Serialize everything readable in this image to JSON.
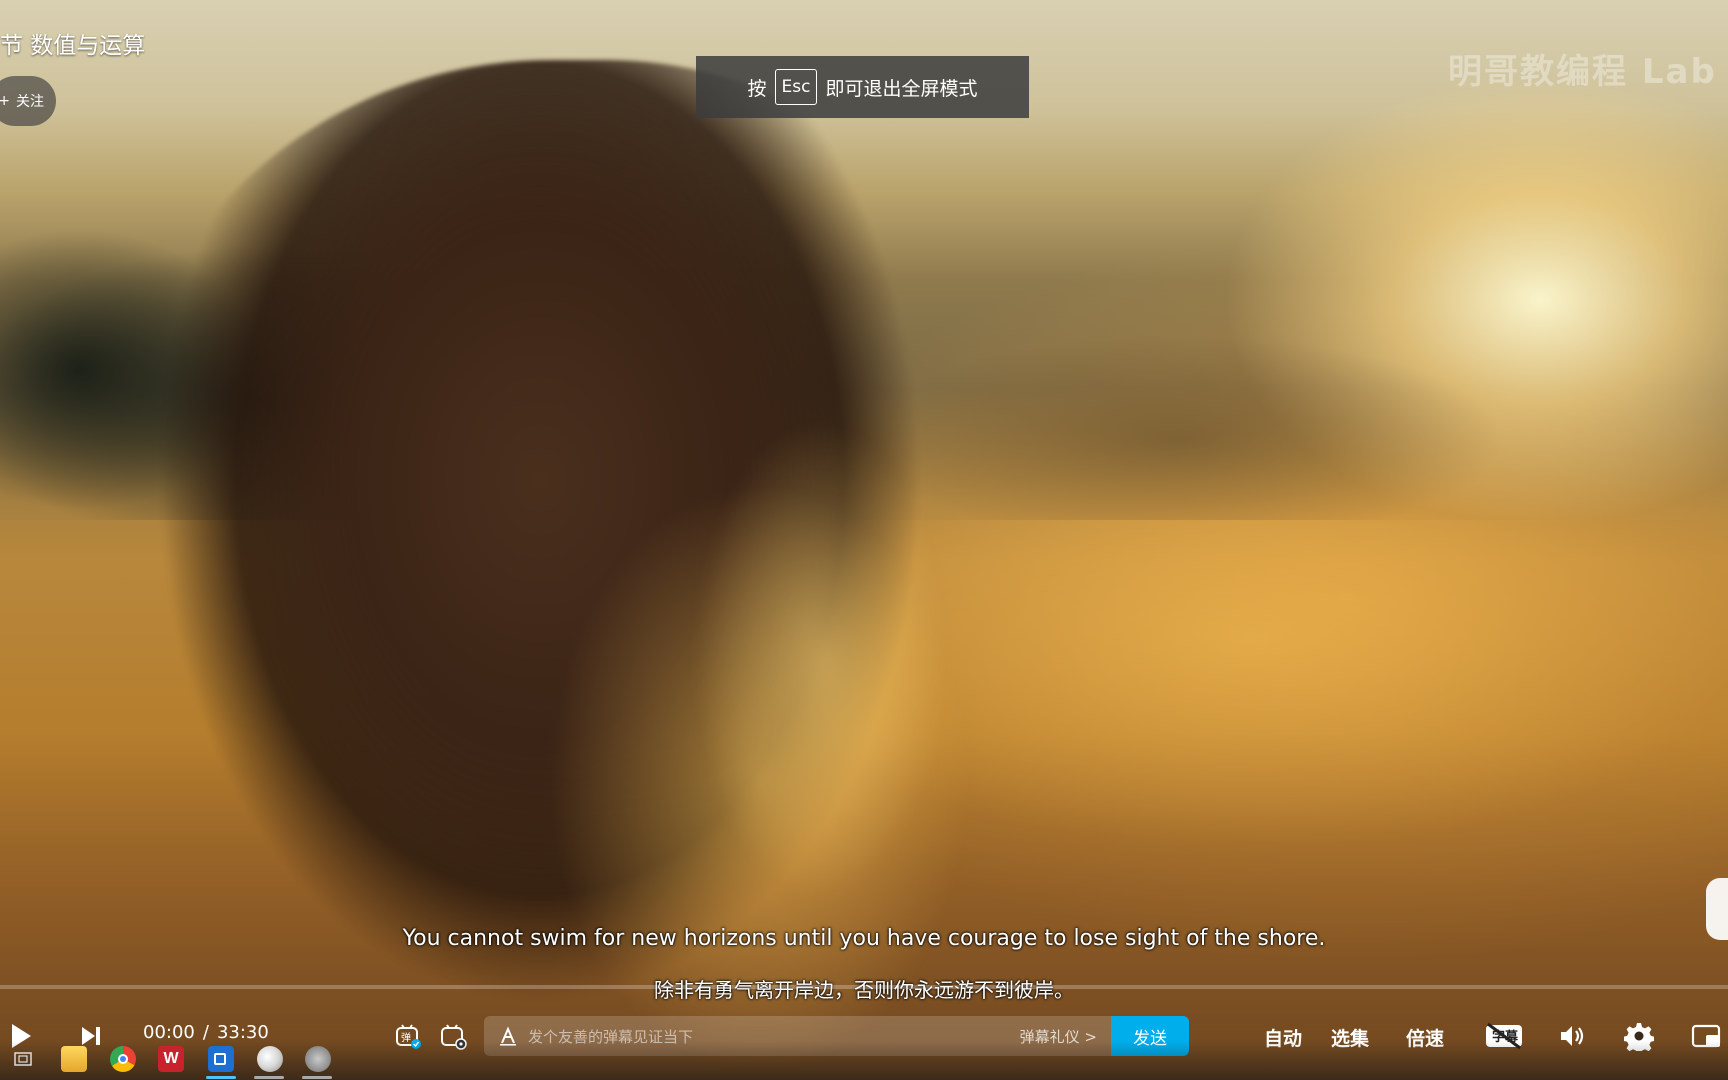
{
  "video": {
    "title": "节 数值与运算",
    "follow_label": "关注",
    "follow_prefix": "+",
    "watermark": "明哥教编程 Lab",
    "subtitle_en": "You cannot swim for new horizons until you have courage to lose sight of the shore.",
    "subtitle_zh": "除非有勇气离开岸边，否则你永远游不到彼岸。"
  },
  "esc_tip": {
    "prefix": "按",
    "key": "Esc",
    "suffix": "即可退出全屏模式"
  },
  "player": {
    "current_time": "00:00",
    "separator": "/",
    "duration": "33:30",
    "progress_fraction": 0.0,
    "danmu_placeholder": "发个友善的弹幕见证当下",
    "danmu_etiquette": "弹幕礼仪 >",
    "send_label": "发送",
    "auto_label": "自动",
    "episodes_label": "选集",
    "speed_label": "倍速",
    "subtitle_label": "字幕",
    "danmu_toggle_on_label": "弹",
    "accent_color": "#00aeec"
  },
  "taskbar": {
    "apps": [
      "file-explorer-icon",
      "chrome-icon",
      "wps-icon",
      "video-app-icon",
      "pinball-icon",
      "bird-app-icon"
    ]
  }
}
